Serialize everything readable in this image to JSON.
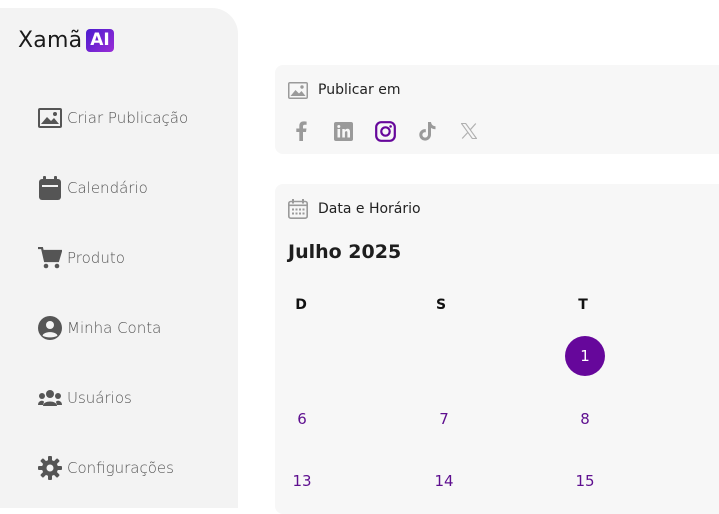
{
  "logo": {
    "text": "Xamã",
    "badge": "AI"
  },
  "sidebar": {
    "items": [
      {
        "label": "Criar Publicação",
        "icon": "image-icon"
      },
      {
        "label": "Calendário",
        "icon": "calendar-icon"
      },
      {
        "label": "Produto",
        "icon": "cart-icon"
      },
      {
        "label": "Minha Conta",
        "icon": "account-icon"
      },
      {
        "label": "Usuários",
        "icon": "users-icon"
      },
      {
        "label": "Configurações",
        "icon": "gear-icon"
      }
    ]
  },
  "publish": {
    "title": "Publicar em",
    "platforms": [
      {
        "name": "facebook",
        "selected": false
      },
      {
        "name": "linkedin",
        "selected": false
      },
      {
        "name": "instagram",
        "selected": true
      },
      {
        "name": "tiktok",
        "selected": false
      },
      {
        "name": "x",
        "selected": false
      }
    ],
    "selected_color": "#66079b",
    "unselected_color": "#9a9a9a"
  },
  "schedule": {
    "title": "Data e Horário",
    "month": "Julho 2025",
    "weekdays": [
      "D",
      "S",
      "T"
    ],
    "rows": [
      [
        "",
        "",
        "1"
      ],
      [
        "6",
        "7",
        "8"
      ],
      [
        "13",
        "14",
        "15"
      ]
    ],
    "selected_day": "1",
    "accent": "#66079b"
  }
}
